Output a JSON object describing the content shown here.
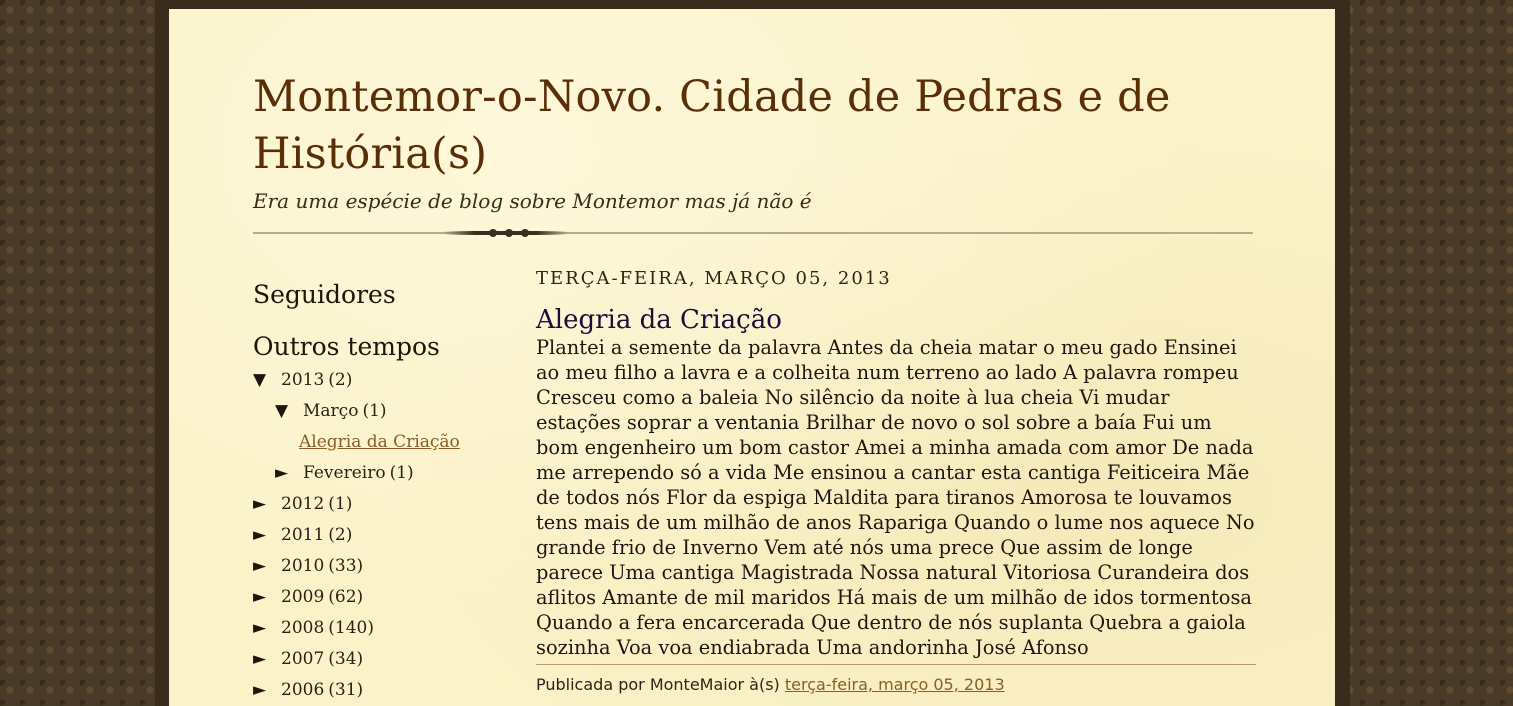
{
  "blog": {
    "title": "Montemor-o-Novo. Cidade de Pedras e de História(s)",
    "description": "Era uma espécie de blog sobre Montemor mas já não é"
  },
  "sidebar": {
    "followers_heading": "Seguidores",
    "archive_heading": "Outros tempos",
    "archive": {
      "y2013": {
        "toggle": "▼",
        "year": "2013",
        "count": "(2)"
      },
      "marco": {
        "toggle": "▼",
        "month": "Março",
        "count": "(1)"
      },
      "post_link": "Alegria da Criação",
      "fevereiro": {
        "toggle": "►",
        "month": "Fevereiro",
        "count": "(1)"
      },
      "years": [
        {
          "toggle": "►",
          "year": "2012",
          "count": "(1)"
        },
        {
          "toggle": "►",
          "year": "2011",
          "count": "(2)"
        },
        {
          "toggle": "►",
          "year": "2010",
          "count": "(33)"
        },
        {
          "toggle": "►",
          "year": "2009",
          "count": "(62)"
        },
        {
          "toggle": "►",
          "year": "2008",
          "count": "(140)"
        },
        {
          "toggle": "►",
          "year": "2007",
          "count": "(34)"
        },
        {
          "toggle": "►",
          "year": "2006",
          "count": "(31)"
        }
      ]
    }
  },
  "post": {
    "date": "TERÇA-FEIRA, MARÇO 05, 2013",
    "title": "Alegria da Criação",
    "body": "Plantei a semente da palavra Antes da cheia matar o meu gado Ensinei ao meu filho a lavra e a colheita num terreno ao lado A palavra rompeu Cresceu como a baleia No silêncio da noite à lua cheia Vi mudar estações soprar a ventania Brilhar de novo o sol sobre a baía Fui um bom engenheiro um bom castor Amei a minha amada com amor De nada me arrependo só a vida Me ensinou a cantar esta cantiga Feiticeira Mãe de todos nós Flor da espiga Maldita para tiranos Amorosa te louvamos tens mais de um milhão de anos Rapariga Quando o lume nos aquece No grande frio de Inverno Vem até nós uma prece Que assim de longe parece Uma cantiga Magistrada Nossa natural Vitoriosa Curandeira dos aflitos Amante de mil maridos Há mais de um milhão de idos tormentosa Quando a fera encarcerada Que dentro de nós suplanta Quebra a gaiola sozinha Voa voa endiabrada Uma andorinha José Afonso",
    "footer_prefix": "Publicada por MonteMaior à(s)",
    "footer_link": "terça-feira, março 05, 2013"
  }
}
